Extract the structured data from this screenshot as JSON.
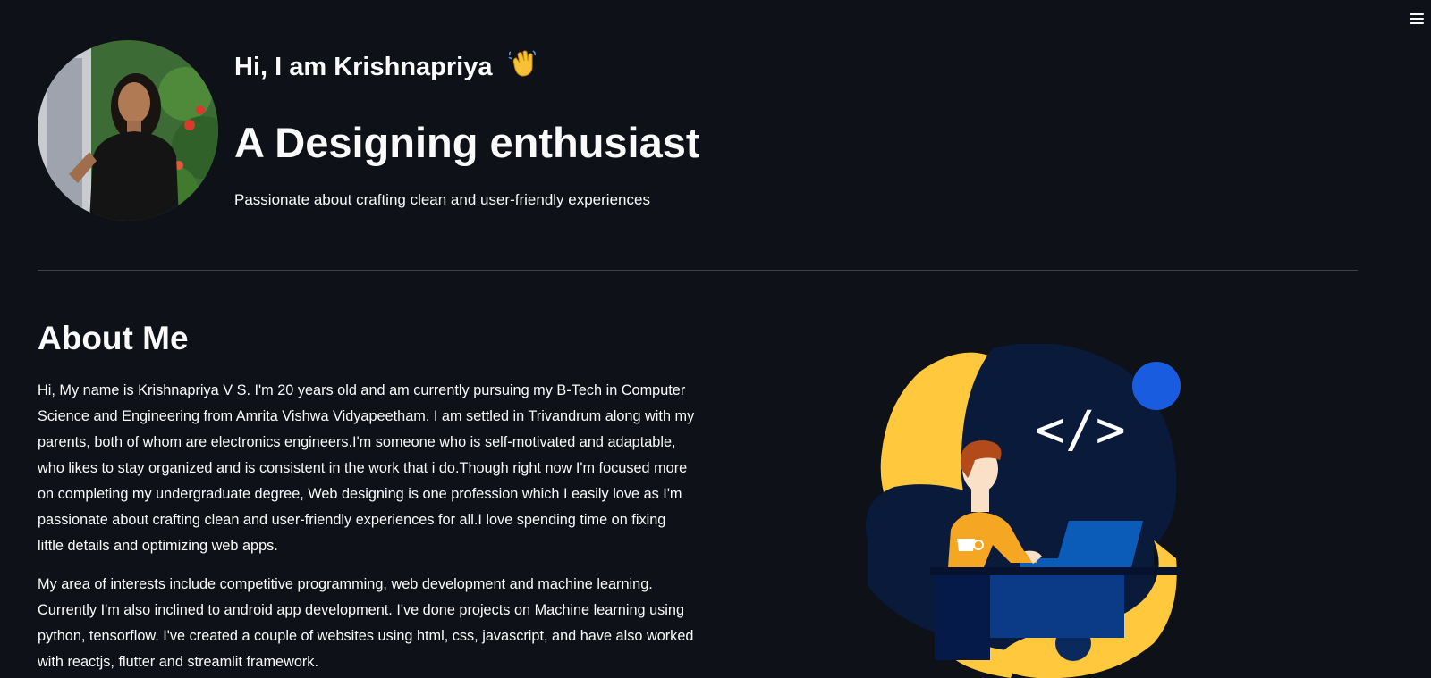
{
  "header": {
    "greeting": "Hi, I am Krishnapriya",
    "wave_emoji": "👋",
    "title": "A Designing enthusiast",
    "subtitle": "Passionate about crafting clean and user-friendly experiences"
  },
  "about": {
    "heading": "About Me",
    "paragraphs": [
      "Hi, My name is Krishnapriya V S. I'm 20 years old and am currently pursuing my B-Tech in Computer Science and Engineering from Amrita Vishwa Vidyapeetham. I am settled in Trivandrum along with my parents, both of whom are electronics engineers.I'm someone who is self-motivated and adaptable, who likes to stay organized and is consistent in the work that i do.Though right now I'm focused more on completing my undergraduate degree, Web designing is one profession which I easily love as I'm passionate about crafting clean and user-friendly experiences for all.I love spending time on fixing little details and optimizing web apps.",
      "My area of interests include competitive programming, web development and machine learning. Currently I'm also inclined to android app development. I've done projects on Machine learning using python, tensorflow. I've created a couple of websites using html, css, javascript, and have also worked with reactjs, flutter and streamlit framework."
    ]
  },
  "illustration": {
    "code_symbol": "</>"
  },
  "icons": {
    "menu": "hamburger-menu-icon",
    "avatar": "profile-photo",
    "illustration": "developer-at-laptop-illustration"
  },
  "colors": {
    "background": "#0e1117",
    "text": "#fafafa",
    "divider": "#3d4049",
    "illustration_yellow": "#ffc83d",
    "illustration_navy": "#0a1a3a",
    "illustration_blue": "#1a5ce0"
  }
}
